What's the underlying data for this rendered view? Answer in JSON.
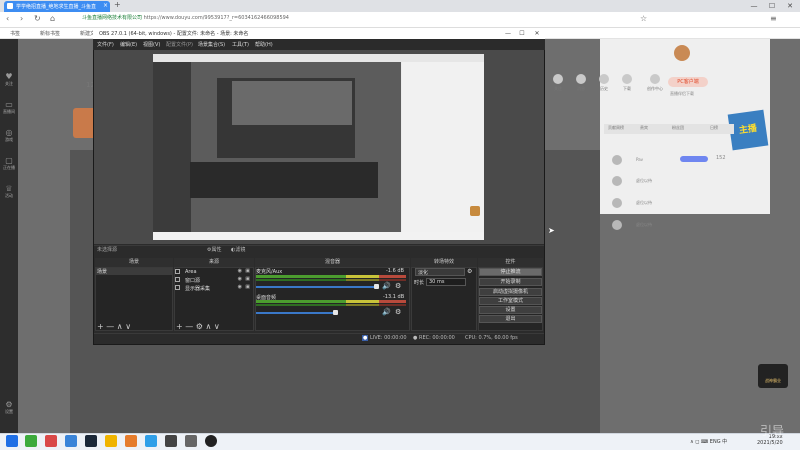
{
  "browser": {
    "tab_title": "学学绝招直播_绝地求生直播_斗鱼直",
    "new_tab": "+",
    "url_secure": "斗鱼直播网络技术有限公司",
    "url": "https://www.douyu.com/9953917",
    "url_query": "?_r=6034162466098594",
    "bookmarks": [
      "书签",
      "新标书签",
      "新建文"
    ],
    "win_min": "—",
    "win_max": "☐",
    "win_close": "✕"
  },
  "page": {
    "count": "12",
    "left_nav": [
      "关注",
      "直播间",
      "游戏",
      "正在播",
      "活动",
      "设置"
    ],
    "right_top": [
      "关注",
      "消息",
      "历史",
      "下载",
      "创作中心"
    ],
    "pc_button": "PC客户端",
    "pc_download": "直播伴侣下载",
    "rank_tabs": [
      "贡献周榜",
      "贵宾",
      "粉丝团",
      "日榜"
    ],
    "rank_names": [
      "Pav",
      "虚位以待",
      "虚位以待",
      "虚位以待"
    ],
    "rank_count": "152",
    "banner": "主播"
  },
  "obs": {
    "title": "OBS 27.0.1 (64-bit, windows) - 配置文件: 未命名 - 场景: 未命名",
    "menu": [
      "文件(F)",
      "编辑(E)",
      "视图(V)",
      "配置文件(P)",
      "场景集合(S)",
      "工具(T)",
      "帮助(H)"
    ],
    "scene_selected": "未选择源",
    "props_label": "属性",
    "filters_label": "滤镜",
    "docks": {
      "scenes": "场景",
      "sources": "来源",
      "mixer": "混音器",
      "transitions": "转场特效",
      "controls": "控件"
    },
    "scene_items": [
      "场景"
    ],
    "sources": [
      "Area",
      "窗口源",
      "显示器采集"
    ],
    "mixer": [
      {
        "name": "麦克风/Aux",
        "db": "-1.6 dB"
      },
      {
        "name": "桌面音频",
        "db": "-13.1 dB"
      }
    ],
    "transition": "淡化",
    "duration_label": "时长",
    "duration": "30 ms",
    "controls": [
      "停止推流",
      "开始录制",
      "启动虚拟摄像机",
      "工作室模式",
      "设置",
      "退出"
    ],
    "status": {
      "live": "LIVE: 00:00:00",
      "rec": "REC: 00:00:00",
      "cpu": "CPU: 0.7%, 60.00 fps"
    },
    "dock_icons": "+ — ∧ ∨",
    "dock_icons2": "+ — ⚙ ∧ ∨"
  },
  "taskbar": {
    "tray": "∧ ◻ ⌨ ENG 中",
    "time": "19:xx",
    "date": "2021/5/20"
  },
  "watermark": "引导",
  "logo_text": "战神霸业"
}
